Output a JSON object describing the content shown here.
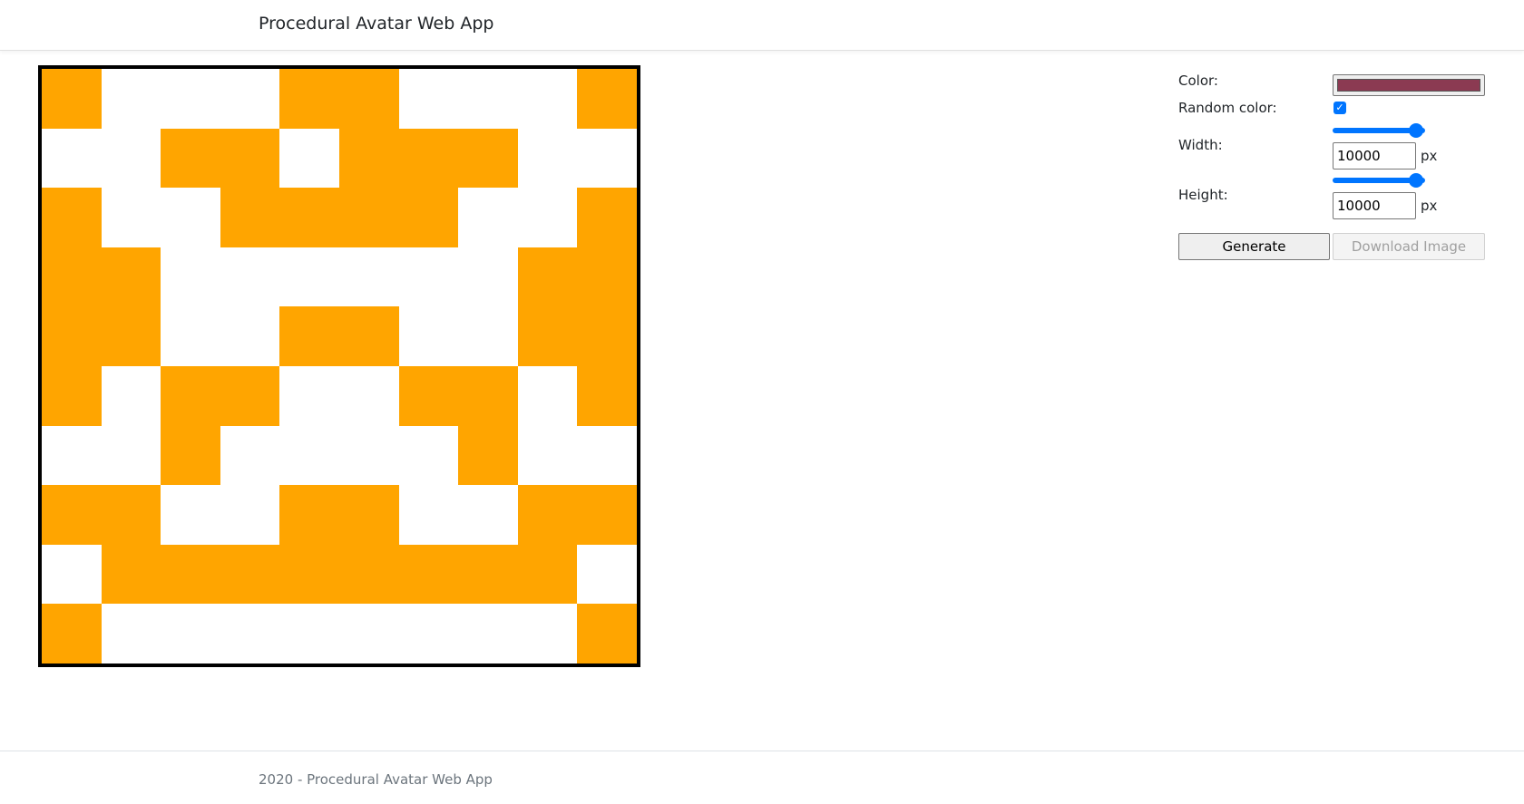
{
  "header": {
    "brand": "Procedural Avatar Web App"
  },
  "avatar": {
    "fill_color": "#ffa500",
    "background_color": "#ffffff",
    "rows": [
      "1000110001",
      "0011011100",
      "1001111001",
      "1100000011",
      "1100110011",
      "1011001101",
      "0010000100",
      "1100110011",
      "0111111110",
      "1000000001"
    ]
  },
  "settings": {
    "color_label": "Color:",
    "color_value": "#8b3a52",
    "random_color_label": "Random color:",
    "random_color_checked": true,
    "width_label": "Width:",
    "width_value": "10000",
    "width_slider_fraction": 0.9,
    "height_label": "Height:",
    "height_value": "10000",
    "height_slider_fraction": 0.9,
    "unit": "px",
    "generate_label": "Generate",
    "download_label": "Download Image"
  },
  "footer": {
    "text": "2020 - Procedural Avatar Web App"
  }
}
